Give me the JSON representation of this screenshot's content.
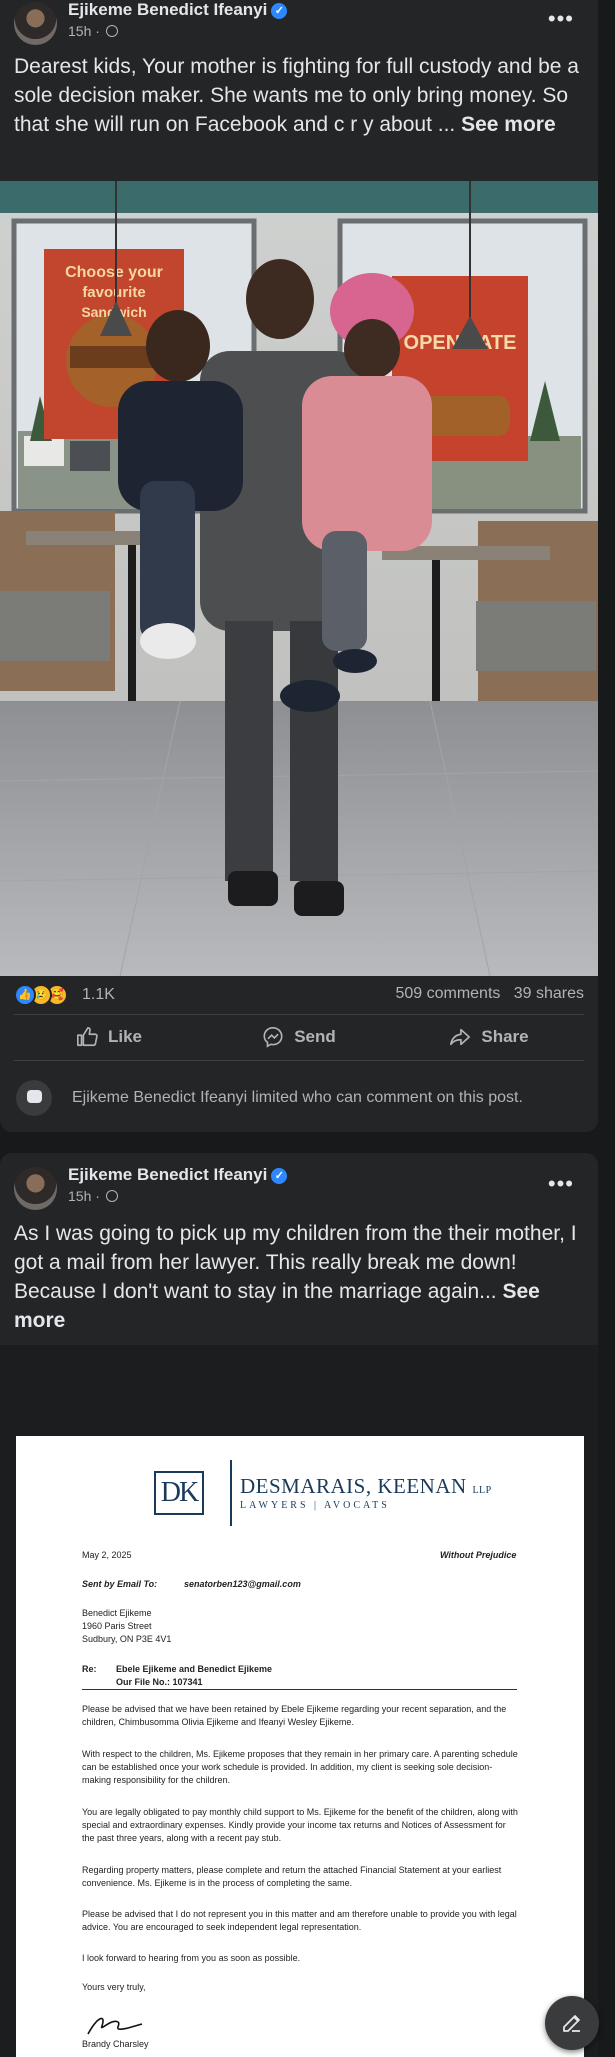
{
  "posts": [
    {
      "author": "Ejikeme Benedict Ifeanyi",
      "time": "15h · ",
      "text": "Dearest kids, Your mother is fighting for full custody and be a sole decision maker. She wants me to only bring money. So that she will run on Facebook and c r y about ... ",
      "see_more": "See more",
      "reaction_count": "1.1K",
      "comments": "509 comments",
      "shares": "39 shares",
      "actions": {
        "like": "Like",
        "send": "Send",
        "share": "Share"
      },
      "notice": "Ejikeme Benedict Ifeanyi limited who can comment on this post."
    },
    {
      "author": "Ejikeme Benedict Ifeanyi",
      "time": "15h · ",
      "text": "As I was going to pick up my children from the their mother, I got a mail from her lawyer. This really break me down! Because I don't want to stay in the marriage again... ",
      "see_more": "See more"
    }
  ],
  "poster": {
    "line1": "Choose your",
    "line2": "favourite",
    "line3": "Sandwich",
    "open_late": "OPEN LATE"
  },
  "letter": {
    "logo": "DK",
    "firm": "DESMARAIS, KEENAN",
    "firm_suffix": "LLP",
    "firm_sub": "LAWYERS | AVOCATS",
    "date": "May 2, 2025",
    "privilege": "Without Prejudice",
    "sent_by_label": "Sent by Email To:",
    "sent_by_email": "senatorben123@gmail.com",
    "addr1": "Benedict Ejikeme",
    "addr2": "1960 Paris Street",
    "addr3": "Sudbury, ON P3E 4V1",
    "re_label": "Re:",
    "re_line1": "Ebele Ejikeme and Benedict Ejikeme",
    "re_line2": "Our File No.: 107341",
    "p1": "Please be advised that we have been retained by Ebele Ejikeme regarding your recent separation, and the children, Chimbusomma Olivia Ejikeme and Ifeanyi Wesley Ejikeme.",
    "p2": "With respect to the children, Ms. Ejikeme proposes that they remain in her primary care. A parenting schedule can be established once your work schedule is provided. In addition, my client is seeking sole decision-making responsibility for the children.",
    "p3": "You are legally obligated to pay monthly child support to Ms. Ejikeme for the benefit of the children, along with special and extraordinary expenses. Kindly provide your income tax returns and Notices of Assessment for the past three years, along with a recent pay stub.",
    "p4": "Regarding property matters, please complete and return the attached Financial Statement at your earliest convenience. Ms. Ejikeme is in the process of completing the same.",
    "p5": "Please be advised that I do not represent you in this matter and am therefore unable to provide you with legal advice. You are encouraged to seek independent legal representation.",
    "p6": "I look forward to hearing from you as soon as possible.",
    "closing": "Yours very truly,",
    "signer": "Brandy Charsley"
  },
  "icons": [
    "verified-badge-icon",
    "globe-icon",
    "more-options-icon",
    "like-reaction-icon",
    "sad-reaction-icon",
    "care-reaction-icon",
    "thumbs-up-icon",
    "messenger-icon",
    "share-arrow-icon",
    "comment-bubble-icon",
    "compose-icon"
  ],
  "colors": {
    "background": "#18191a",
    "card": "#242526",
    "text": "#e4e6eb",
    "secondary": "#b0b3b8",
    "verified": "#2d88ff",
    "divider": "#3e4042"
  }
}
